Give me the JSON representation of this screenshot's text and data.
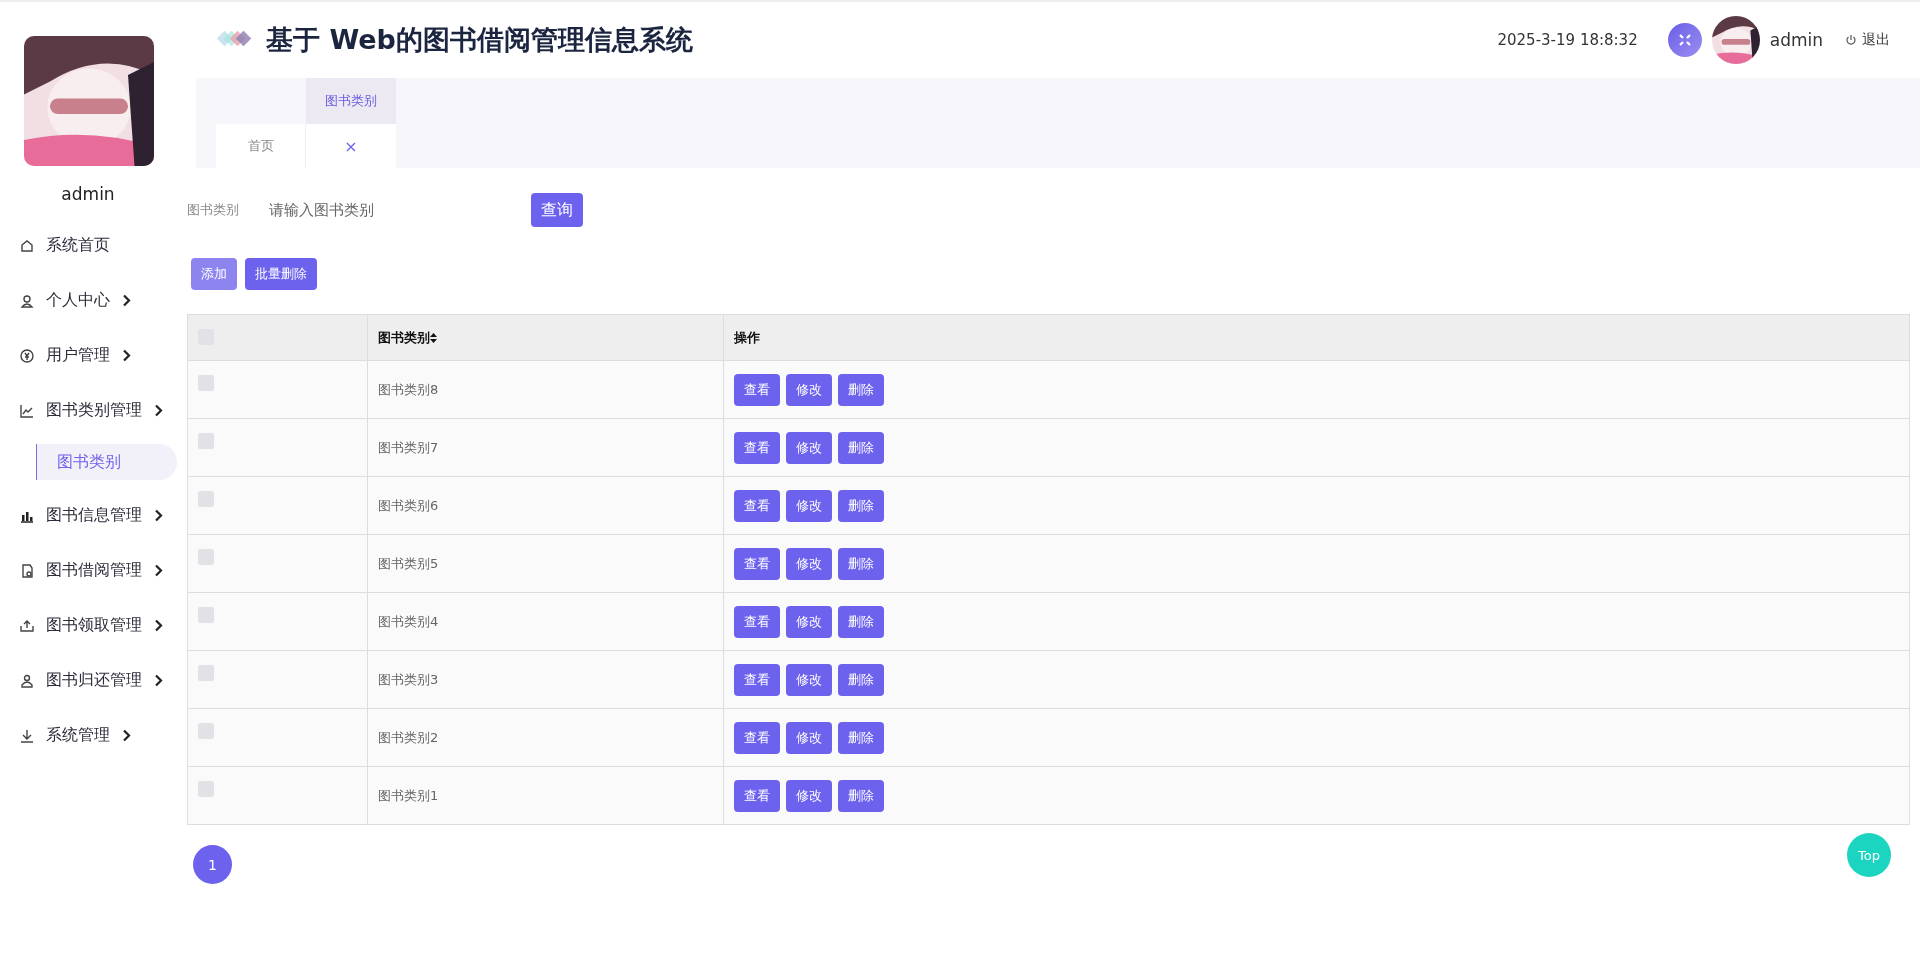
{
  "sidebar": {
    "user": {
      "name": "admin"
    },
    "menu": [
      {
        "label": "系统首页",
        "kind": "link"
      },
      {
        "label": "个人中心",
        "kind": "group"
      },
      {
        "label": "用户管理",
        "kind": "group"
      },
      {
        "label": "图书类别管理",
        "kind": "group",
        "children": [
          {
            "label": "图书类别",
            "selected": true
          }
        ]
      },
      {
        "label": "图书信息管理",
        "kind": "group"
      },
      {
        "label": "图书借阅管理",
        "kind": "group"
      },
      {
        "label": "图书领取管理",
        "kind": "group"
      },
      {
        "label": "图书归还管理",
        "kind": "group"
      },
      {
        "label": "系统管理",
        "kind": "group"
      }
    ]
  },
  "header": {
    "title": "基于 Web的图书借阅管理信息系统",
    "datetime": "2025-3-19 18:8:32",
    "user": "admin",
    "logout": "退出"
  },
  "tabs": [
    {
      "label": "首页",
      "selected": false
    },
    {
      "label": "图书类别",
      "selected": true,
      "close": "×"
    }
  ],
  "search": {
    "label": "图书类别",
    "placeholder": "请输入图书类别",
    "button": "查询"
  },
  "actions": [
    "添加",
    "批量删除"
  ],
  "table": {
    "select_all_checked": false,
    "columns": [
      {
        "label": "图书类别",
        "sortable": true
      },
      {
        "label": "操作",
        "sortable": false
      }
    ],
    "rows": [
      {
        "category": "图书类别8",
        "checked": false,
        "buttons": [
          "查看",
          "修改",
          "删除"
        ]
      },
      {
        "category": "图书类别7",
        "checked": false,
        "buttons": [
          "查看",
          "修改",
          "删除"
        ]
      },
      {
        "category": "图书类别6",
        "checked": false,
        "buttons": [
          "查看",
          "修改",
          "删除"
        ]
      },
      {
        "category": "图书类别5",
        "checked": false,
        "buttons": [
          "查看",
          "修改",
          "删除"
        ]
      },
      {
        "category": "图书类别4",
        "checked": false,
        "buttons": [
          "查看",
          "修改",
          "删除"
        ]
      },
      {
        "category": "图书类别3",
        "checked": false,
        "buttons": [
          "查看",
          "修改",
          "删除"
        ]
      },
      {
        "category": "图书类别2",
        "checked": false,
        "buttons": [
          "查看",
          "修改",
          "删除"
        ]
      },
      {
        "category": "图书类别1",
        "checked": false,
        "buttons": [
          "查看",
          "修改",
          "删除"
        ]
      }
    ]
  },
  "pagination": [
    {
      "label": "1",
      "selected": true
    }
  ],
  "back_to_top": "Top"
}
